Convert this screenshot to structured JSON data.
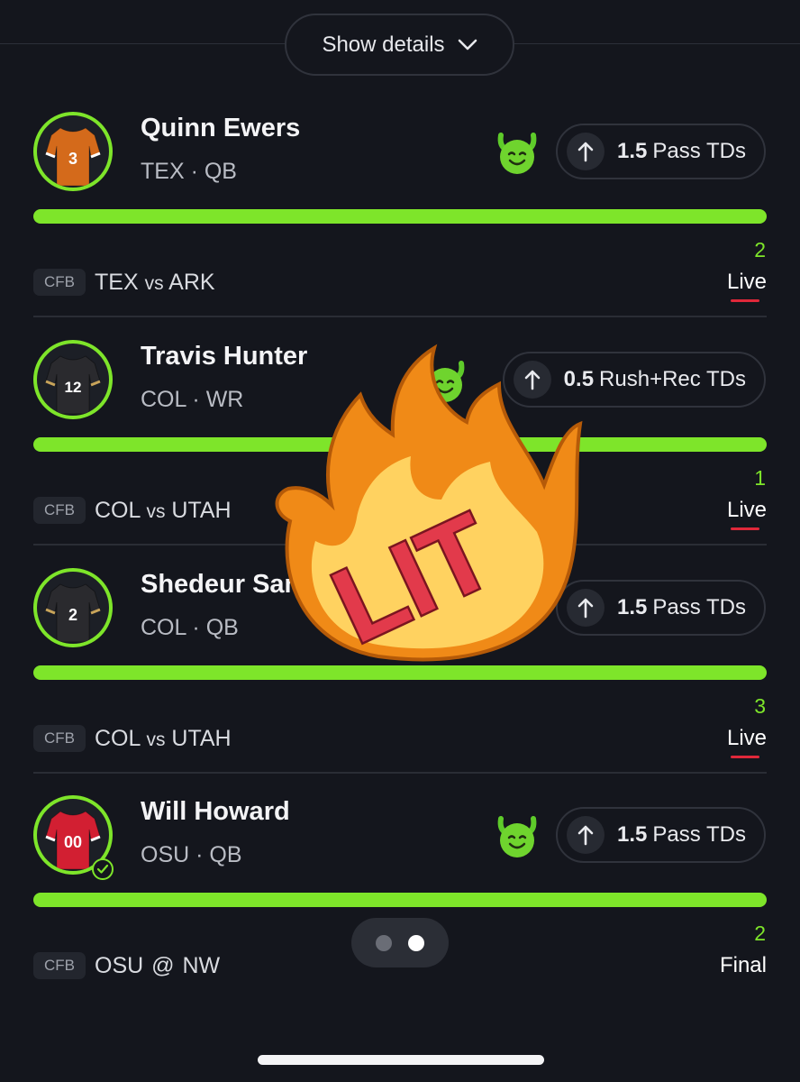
{
  "header": {
    "show_details_label": "Show details"
  },
  "picks": [
    {
      "player_name": "Quinn Ewers",
      "team_position": "TEX · QB",
      "jersey_number": "3",
      "jersey_color": "#d46a1b",
      "jersey_trim": "#ffffff",
      "pick_direction": "up",
      "line": "1.5",
      "stat": "Pass TDs",
      "progress": 1.0,
      "current_value": "2",
      "league": "CFB",
      "team": "TEX",
      "separator": "vs",
      "opponent": "ARK",
      "status": "Live",
      "settled": false
    },
    {
      "player_name": "Travis Hunter",
      "team_position": "COL · WR",
      "jersey_number": "12",
      "jersey_color": "#2a2a2e",
      "jersey_trim": "#c8a45a",
      "pick_direction": "up",
      "line": "0.5",
      "stat": "Rush+Rec TDs",
      "progress": 1.0,
      "current_value": "1",
      "league": "CFB",
      "team": "COL",
      "separator": "vs",
      "opponent": "UTAH",
      "status": "Live",
      "settled": false
    },
    {
      "player_name": "Shedeur Sande",
      "team_position": "COL · QB",
      "jersey_number": "2",
      "jersey_color": "#2a2a2e",
      "jersey_trim": "#c8a45a",
      "pick_direction": "up",
      "line": "1.5",
      "stat": "Pass TDs",
      "progress": 1.0,
      "current_value": "3",
      "league": "CFB",
      "team": "COL",
      "separator": "vs",
      "opponent": "UTAH",
      "status": "Live",
      "settled": false
    },
    {
      "player_name": "Will Howard",
      "team_position": "OSU · QB",
      "jersey_number": "00",
      "jersey_color": "#d21f32",
      "jersey_trim": "#ffffff",
      "pick_direction": "up",
      "line": "1.5",
      "stat": "Pass TDs",
      "progress": 1.0,
      "current_value": "2",
      "league": "CFB",
      "team": "OSU",
      "separator": "@",
      "opponent": "NW",
      "status": "Final",
      "settled": true
    }
  ],
  "pager": {
    "total": 2,
    "active": 2
  },
  "sticker": {
    "text": "LIT",
    "icon": "fire-sticker-icon"
  },
  "colors": {
    "accent": "#7ee52a",
    "live": "#e0283a",
    "background": "#14161d"
  }
}
